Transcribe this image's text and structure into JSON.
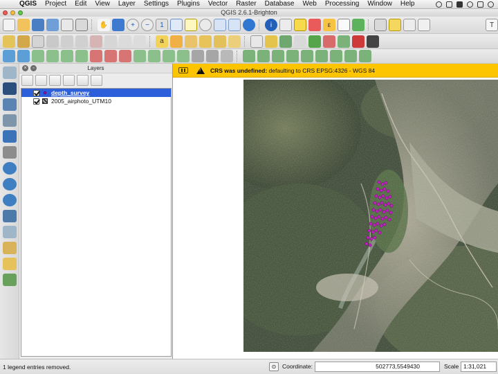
{
  "menubar": {
    "app_name": "QGIS",
    "menus": [
      "Project",
      "Edit",
      "View",
      "Layer",
      "Settings",
      "Plugins",
      "Vector",
      "Raster",
      "Database",
      "Web",
      "Processing",
      "Window",
      "Help"
    ]
  },
  "window": {
    "title": "QGIS 2.6.1-Brighton"
  },
  "layers_panel": {
    "title": "Layers",
    "layers": [
      {
        "name": "depth_survey",
        "visible": true,
        "selected": true,
        "type": "point",
        "symbol_color": "#c020c0"
      },
      {
        "name": "2005_airphoto_UTM10",
        "visible": true,
        "selected": false,
        "type": "raster"
      }
    ]
  },
  "message_bar": {
    "title": "CRS was undefined:",
    "text": " defaulting to CRS EPSG:4326 - WGS 84",
    "color": "#fdc400"
  },
  "status_bar": {
    "message": "1 legend entries removed.",
    "coordinate_label": "Coordinate:",
    "coordinate_value": "502773,5549430",
    "scale_label": "Scale",
    "scale_value": "1:31,021"
  }
}
